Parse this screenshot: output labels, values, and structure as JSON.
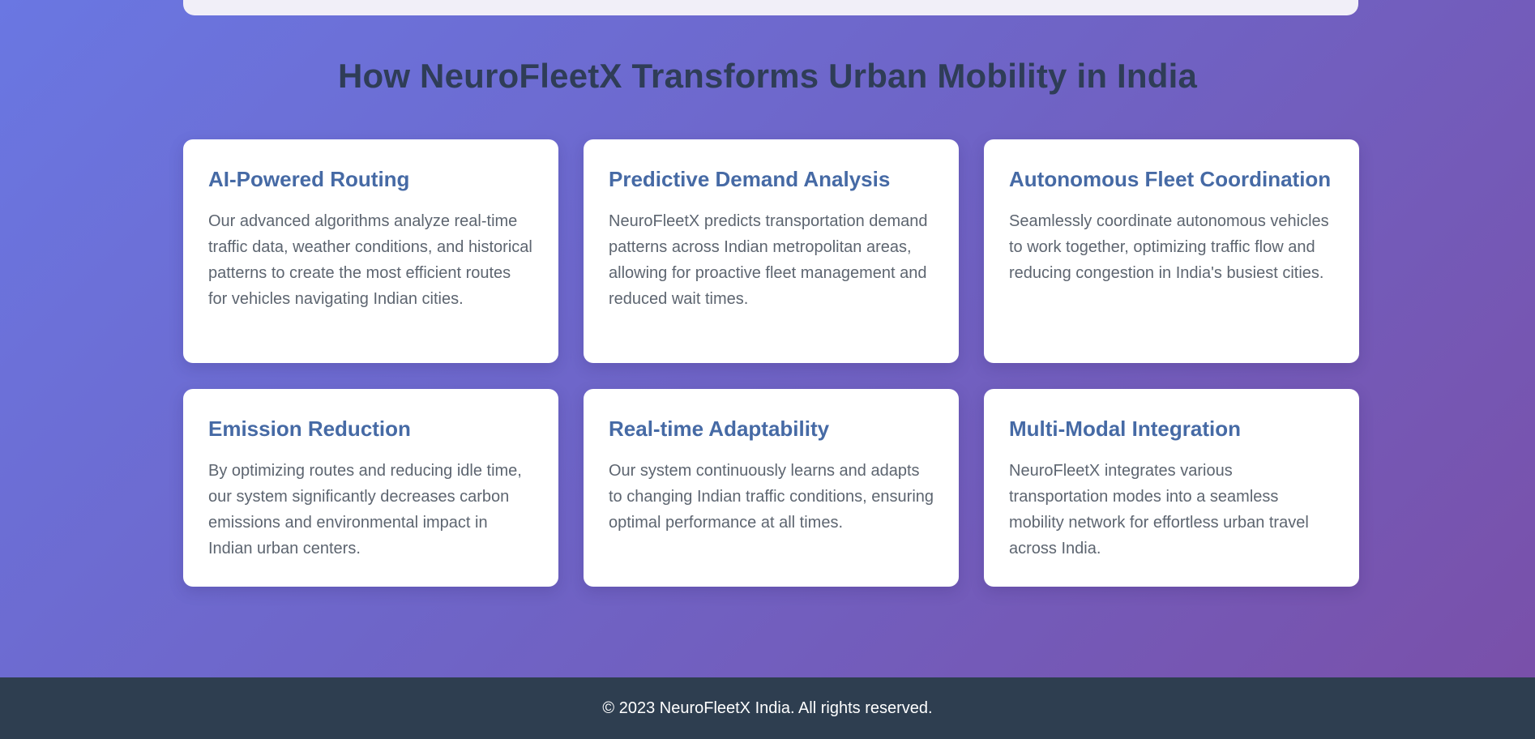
{
  "section": {
    "title": "How NeuroFleetX Transforms Urban Mobility in India"
  },
  "features": [
    {
      "title": "AI-Powered Routing",
      "description": "Our advanced algorithms analyze real-time traffic data, weather conditions, and historical patterns to create the most efficient routes for vehicles navigating Indian cities."
    },
    {
      "title": "Predictive Demand Analysis",
      "description": "NeuroFleetX predicts transportation demand patterns across Indian metropolitan areas, allowing for proactive fleet management and reduced wait times."
    },
    {
      "title": "Autonomous Fleet Coordination",
      "description": "Seamlessly coordinate autonomous vehicles to work together, optimizing traffic flow and reducing congestion in India's busiest cities."
    },
    {
      "title": "Emission Reduction",
      "description": "By optimizing routes and reducing idle time, our system significantly decreases carbon emissions and environmental impact in Indian urban centers."
    },
    {
      "title": "Real-time Adaptability",
      "description": "Our system continuously learns and adapts to changing Indian traffic conditions, ensuring optimal performance at all times."
    },
    {
      "title": "Multi-Modal Integration",
      "description": "NeuroFleetX integrates various transportation modes into a seamless mobility network for effortless urban travel across India."
    }
  ],
  "footer": {
    "copyright": "© 2023 NeuroFleetX India. All rights reserved."
  },
  "colors": {
    "gradient_start": "#6a77e2",
    "gradient_end": "#7a4fa8",
    "title_text": "#2f3d57",
    "card_heading": "#466aa5",
    "card_text": "#5d6570",
    "footer_bg": "#2e3e50"
  }
}
